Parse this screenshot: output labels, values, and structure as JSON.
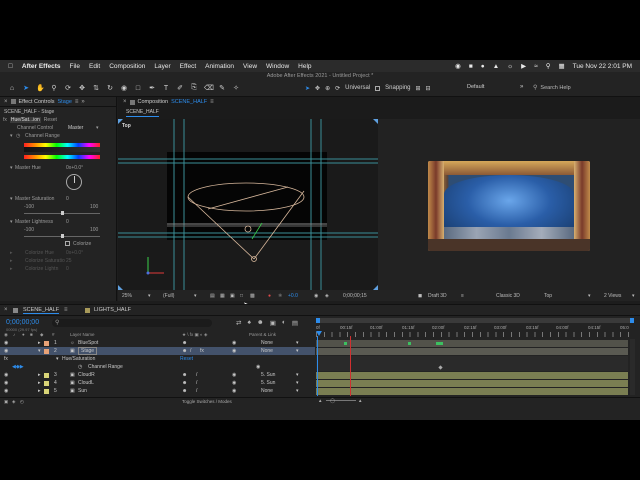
{
  "menubar": {
    "apple": "",
    "app_name": "After Effects",
    "items": [
      "File",
      "Edit",
      "Composition",
      "Layer",
      "Effect",
      "Animation",
      "View",
      "Window",
      "Help"
    ],
    "clock": "Tue Nov 22  2:01 PM"
  },
  "window": {
    "title": "Adobe After Effects 2021 - Untitled Project *"
  },
  "toolbar": {
    "universal": "Universal",
    "snapping": "Snapping",
    "workspace": "Default",
    "search_placeholder": "Search Help"
  },
  "effect_controls": {
    "tab_label": "Effect Controls",
    "tab_layer": "Stage",
    "breadcrumb": "SCENE_HALF - Stage",
    "effect_name": "Hue/Sat...ion",
    "reset": "Reset",
    "channel_control_label": "Channel Control",
    "channel_control_value": "Master",
    "channel_range_label": "Channel Range",
    "master_hue_label": "Master Hue",
    "master_hue_value": "0x+0.0°",
    "master_saturation_label": "Master Saturation",
    "master_saturation_value": "0",
    "sat_min": "-100",
    "sat_max": "100",
    "master_lightness_label": "Master Lightness",
    "master_lightness_value": "0",
    "light_min": "-100",
    "light_max": "100",
    "colorize_label": "Colorize",
    "colorize_hue_label": "Colorize Hue",
    "colorize_hue_value": "0x+0.0°",
    "colorize_sat_label": "Colorize Saturatio",
    "colorize_sat_value": "25",
    "colorize_light_label": "Colorize Lightn",
    "colorize_light_value": "0"
  },
  "composition": {
    "tab_label": "Composition",
    "tab_name": "SCENE_HALF",
    "sub_tab": "SCENE_HALF",
    "view_label": "Top",
    "zoom": "25%",
    "resolution": "(Full)",
    "exposure": "+0.0",
    "timecode": "0;00;00;15",
    "renderer": "Draft 3D",
    "camera": "Classic 3D",
    "view_select": "Top",
    "views_count": "2 Views"
  },
  "timeline": {
    "tabs": [
      {
        "name": "SCENE_HALF"
      },
      {
        "name": "LIGHTS_HALF"
      }
    ],
    "timecode": "0;00;00;00",
    "fps": "00000 (29.97 fps)",
    "search_placeholder": "",
    "col_layer_name": "Layer Name",
    "col_parent": "Parent & Link",
    "ruler_ticks": [
      "0f",
      "00:15f",
      "01:00f",
      "01:15f",
      "02:00f",
      "02:15f",
      "03:00f",
      "03:15f",
      "04:00f",
      "04:15f",
      "05:0"
    ],
    "layers": [
      {
        "num": "1",
        "name": "BlueSpot",
        "parent": "None",
        "color": "#e8a277"
      },
      {
        "num": "2",
        "name": "Stage",
        "parent": "None",
        "color": "#e8a277"
      },
      {
        "num": "3",
        "name": "CloudR",
        "parent": "5. Sun",
        "color": "#d8d477"
      },
      {
        "num": "4",
        "name": "CloudL",
        "parent": "5. Sun",
        "color": "#d8d477"
      },
      {
        "num": "5",
        "name": "Sun",
        "parent": "None",
        "color": "#d8d477"
      }
    ],
    "effect_row": "Hue/Saturation",
    "effect_reset": "Reset",
    "prop_row": "Channel Range",
    "toggle_label": "Toggle Switches / Modes",
    "colors": {
      "selected_layer": "#43526b",
      "track_gray": "#52524a",
      "track_yellow": "#7a7e52",
      "playhead": "#d03030",
      "in_marker": "#2d8ceb"
    }
  }
}
